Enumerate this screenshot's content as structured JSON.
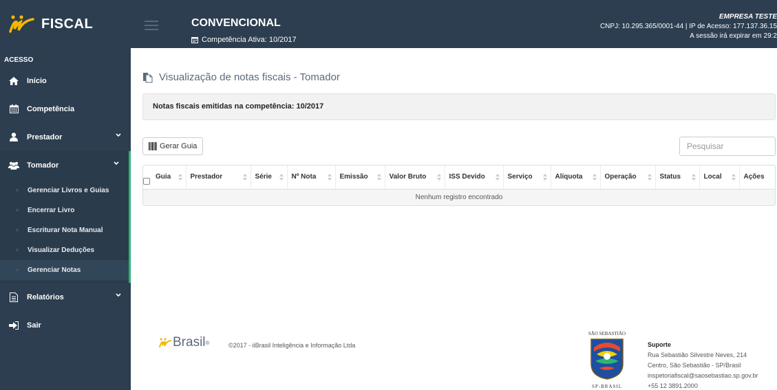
{
  "brand": {
    "name": "FISCAL"
  },
  "sidebar": {
    "section": "ACESSO",
    "items": [
      {
        "label": "Início",
        "icon": "home-icon"
      },
      {
        "label": "Competência",
        "icon": "calendar-icon"
      },
      {
        "label": "Prestador",
        "icon": "user-icon",
        "expandable": true
      },
      {
        "label": "Tomador",
        "icon": "users-icon",
        "expandable": true,
        "expanded": true
      },
      {
        "label": "Relatórios",
        "icon": "file-text-icon",
        "expandable": true
      },
      {
        "label": "Sair",
        "icon": "sign-out-icon"
      }
    ],
    "tomador_submenu": [
      "Gerenciar Livros e Guias",
      "Encerrar Livro",
      "Escriturar Nota Manual",
      "Visualizar Deduções",
      "Gerenciar Notas"
    ]
  },
  "header": {
    "module": "CONVENCIONAL",
    "competencia": "Competência Ativa: 10/2017",
    "empresa": "EMPRESA TESTE",
    "cnpj_ip": "CNPJ: 10.295.365/0001-44 | IP de Acesso: 177.137.36.15",
    "session": "A sessão irá expirar em 29:2"
  },
  "main": {
    "title": "Visualização de notas fiscais - Tomador",
    "info": "Notas fiscais emitidas na competência: 10/2017",
    "gerar_guia": "Gerar Guia",
    "search_placeholder": "Pesquisar",
    "columns": [
      "Guia",
      "Prestador",
      "Série",
      "Nº Nota",
      "Emissão",
      "Valor Bruto",
      "ISS Devido",
      "Serviço",
      "Alíquota",
      "Operação",
      "Status",
      "Local",
      "Ações"
    ],
    "empty": "Nenhum registro encontrado"
  },
  "footer": {
    "brand": "Brasil",
    "copyright": "©2017 - iiBrasil Inteligência e Informação Ltda",
    "seal_top": "SÃO SEBASTIÃO",
    "seal_bottom": "SP-BRASIL",
    "support_title": "Suporte",
    "support_lines": [
      "Rua Sebastião Silvestre Neves, 214",
      "Centro, São Sebastião - SP/Brasil",
      "inspetoriafiscal@saosebastiao.sp.gov.br",
      "+55 12 3891.2000"
    ]
  },
  "colors": {
    "sidebar": "#2c3e50",
    "accent": "#2bb673",
    "logo": "#f5b700"
  }
}
